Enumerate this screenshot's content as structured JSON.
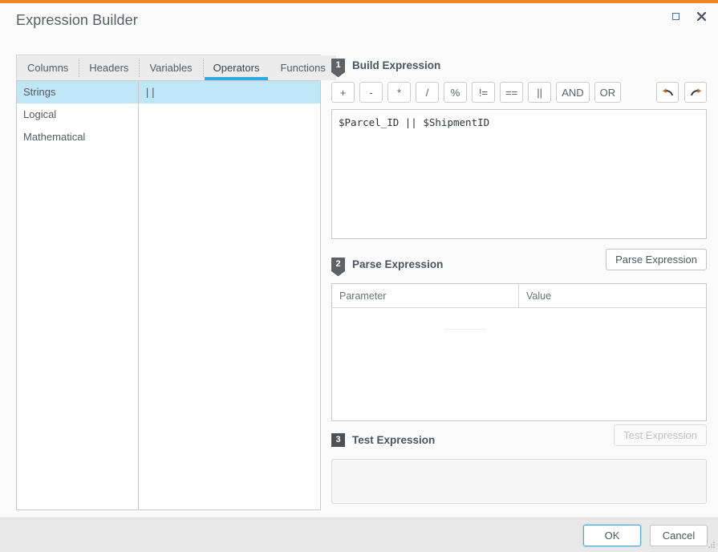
{
  "window": {
    "title": "Expression Builder",
    "accent_color": "#ef8722",
    "maximize_icon": "square-icon",
    "close_icon": "close-icon",
    "close_glyph": "✕"
  },
  "browser": {
    "tabs": [
      {
        "label": "Columns",
        "active": false
      },
      {
        "label": "Headers",
        "active": false
      },
      {
        "label": "Variables",
        "active": false
      },
      {
        "label": "Operators",
        "active": true
      },
      {
        "label": "Functions",
        "active": false
      }
    ],
    "categories": [
      {
        "label": "Strings",
        "selected": true
      },
      {
        "label": "Logical",
        "selected": false
      },
      {
        "label": "Mathematical",
        "selected": false
      }
    ],
    "items": [
      {
        "label": "||",
        "selected": true
      }
    ]
  },
  "build": {
    "step_number": "1",
    "step_title": "Build Expression",
    "operators": [
      "+",
      "-",
      "*",
      "/",
      "%",
      "!=",
      "==",
      "||",
      "AND",
      "OR"
    ],
    "undo_icon": "undo-arrow-icon",
    "redo_icon": "redo-arrow-icon",
    "expression": "$Parcel_ID || $ShipmentID"
  },
  "parse": {
    "step_number": "2",
    "step_title": "Parse Expression",
    "button_label": "Parse Expression",
    "columns": [
      "Parameter",
      "Value"
    ],
    "rows": []
  },
  "test": {
    "step_number": "3",
    "step_title": "Test Expression",
    "button_label": "Test Expression",
    "button_disabled": true,
    "result": ""
  },
  "footer": {
    "ok_label": "OK",
    "cancel_label": "Cancel"
  }
}
